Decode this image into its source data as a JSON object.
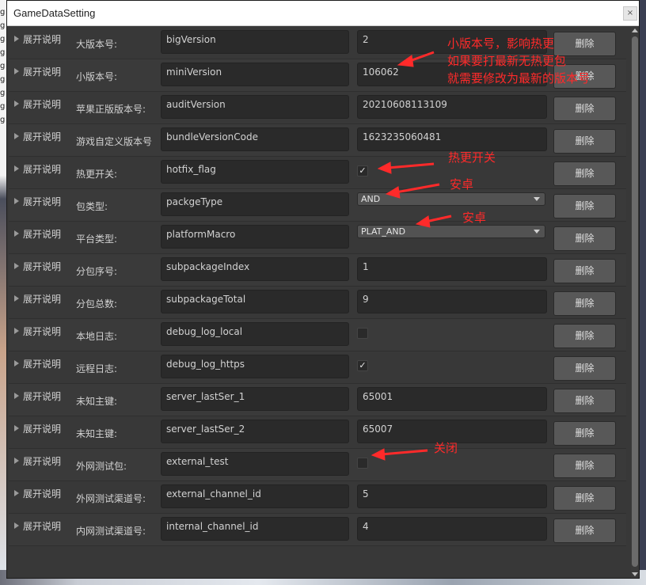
{
  "window": {
    "title": "GameDataSetting"
  },
  "close_icon": "×",
  "background_letters": [
    "g",
    "g",
    "g",
    "g",
    "g",
    "g",
    "g",
    "g",
    "g"
  ],
  "expand_label": "展开说明",
  "delete_label": "删除",
  "rows": [
    {
      "label": "大版本号:",
      "key": "bigVersion",
      "type": "text",
      "value": "2"
    },
    {
      "label": "小版本号:",
      "key": "miniVersion",
      "type": "text",
      "value": "106062"
    },
    {
      "label": "苹果正版版本号:",
      "key": "auditVersion",
      "type": "text",
      "value": "20210608113109"
    },
    {
      "label": "游戏自定义版本号",
      "key": "bundleVersionCode",
      "type": "text",
      "value": "1623235060481"
    },
    {
      "label": "热更开关:",
      "key": "hotfix_flag",
      "type": "checkbox",
      "checked": true
    },
    {
      "label": "包类型:",
      "key": "packgeType",
      "type": "dropdown",
      "value": "AND"
    },
    {
      "label": "平台类型:",
      "key": "platformMacro",
      "type": "dropdown",
      "value": "PLAT_AND"
    },
    {
      "label": "分包序号:",
      "key": "subpackageIndex",
      "type": "text",
      "value": "1"
    },
    {
      "label": "分包总数:",
      "key": "subpackageTotal",
      "type": "text",
      "value": "9"
    },
    {
      "label": "本地日志:",
      "key": "debug_log_local",
      "type": "checkbox",
      "checked": false
    },
    {
      "label": "远程日志:",
      "key": "debug_log_https",
      "type": "checkbox",
      "checked": true
    },
    {
      "label": "未知主键:",
      "key": "server_lastSer_1",
      "type": "text",
      "value": "65001"
    },
    {
      "label": "未知主键:",
      "key": "server_lastSer_2",
      "type": "text",
      "value": "65007"
    },
    {
      "label": "外网测试包:",
      "key": "external_test",
      "type": "checkbox",
      "checked": false
    },
    {
      "label": "外网测试渠道号:",
      "key": "external_channel_id",
      "type": "text",
      "value": "5"
    },
    {
      "label": "内网测试渠道号:",
      "key": "internal_channel_id",
      "type": "text",
      "value": "4"
    }
  ],
  "annotations": {
    "mini_version_note": [
      "小版本号，影响热更",
      "如果要打最新无热更包",
      "就需要修改为最新的版本号"
    ],
    "hotfix_note": "热更开关",
    "package_note": "安卓",
    "platform_note": "安卓",
    "external_note": "关闭",
    "color": "#ff2a2a"
  }
}
